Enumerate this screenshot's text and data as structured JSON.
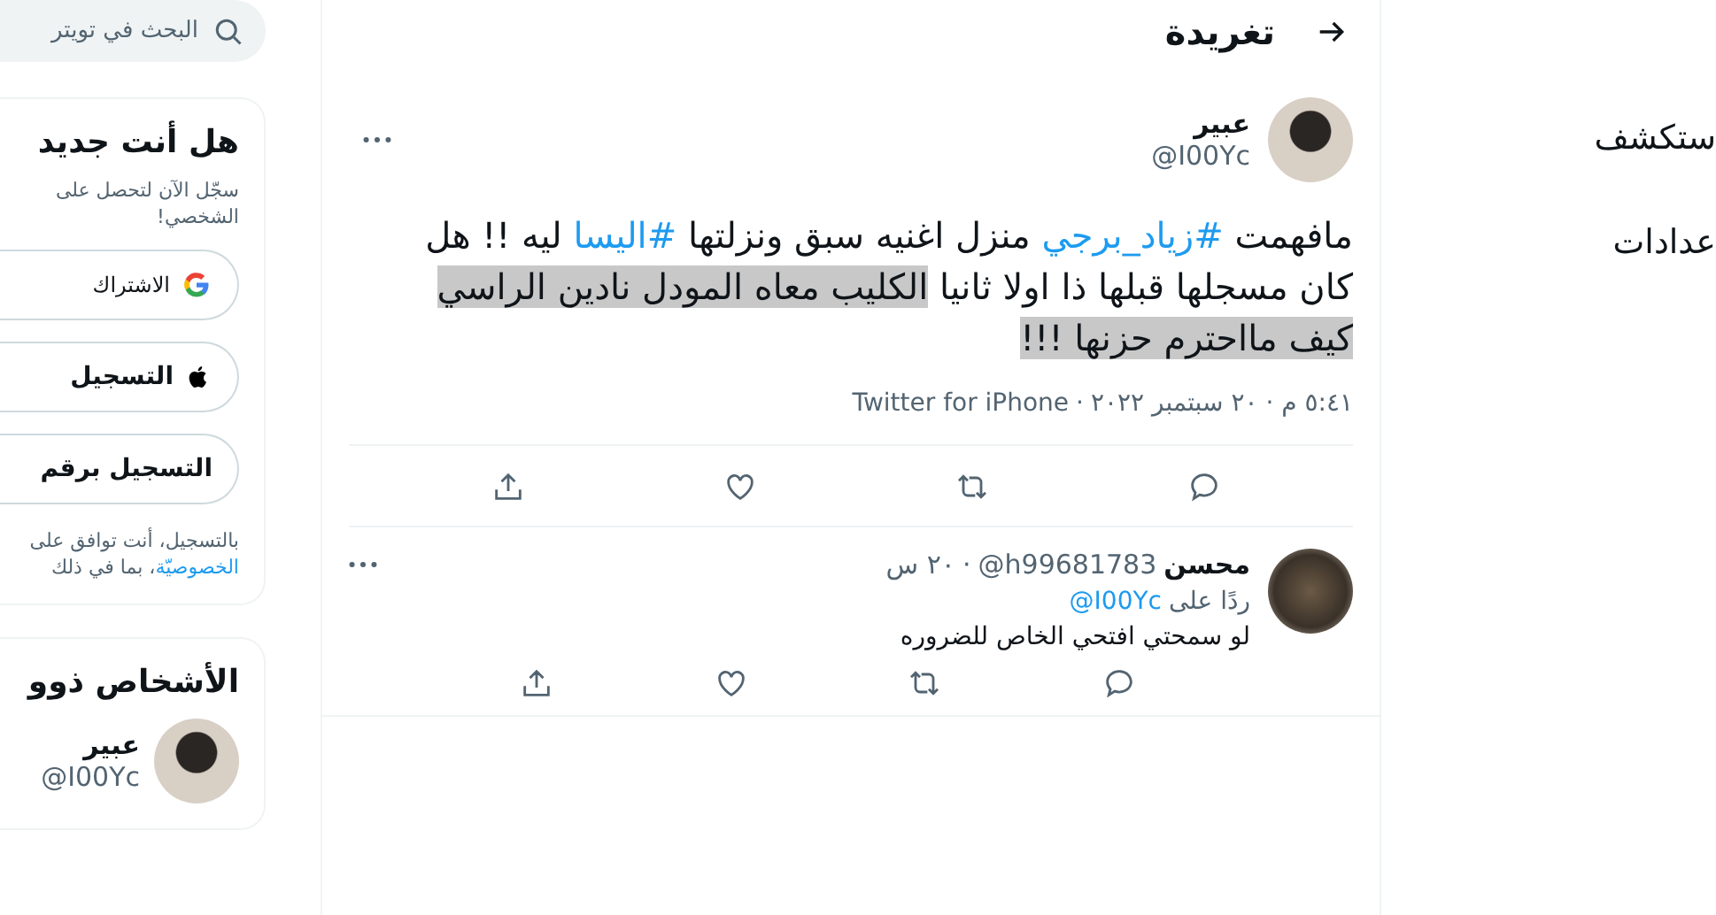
{
  "nav": {
    "items": [
      {
        "label": "ستكشف"
      },
      {
        "label": "عدادات"
      }
    ]
  },
  "header": {
    "title": "تغريدة"
  },
  "main_tweet": {
    "author": {
      "name": "عبير",
      "handle": "@I00Yc"
    },
    "text_segments": [
      {
        "kind": "text",
        "text": "مافهمت "
      },
      {
        "kind": "hashtag",
        "text": "#زياد_برجي"
      },
      {
        "kind": "text",
        "text": " منزل اغنيه سبق ونزلتها "
      },
      {
        "kind": "hashtag",
        "text": "#اليسا"
      },
      {
        "kind": "text",
        "text": " ليه !! هل كان مسجلها قبلها ذا اولا ثانيا "
      },
      {
        "kind": "highlighted",
        "text": "الكليب معاه المودل نادين الراسي كيف مااحترم حزنها !!!"
      }
    ],
    "timestamp": "٥:٤١ م · ٢٠ سبتمبر ٢٠٢٢",
    "separator": "·",
    "source": "Twitter for iPhone"
  },
  "reply": {
    "author": {
      "name": "محسن",
      "handle": "@h99681783"
    },
    "separator": "·",
    "time": "٢٠ س",
    "replying_to": "ردًا على",
    "mention": "@I00Yc",
    "text": "لو سمحتي افتحي الخاص للضروره"
  },
  "sidebar": {
    "search": {
      "placeholder": "البحث في تويتر"
    },
    "signup_card": {
      "title": "هل أنت جديد",
      "description_lines": [
        "سجّل الآن لتحصل على",
        "الشخصي!"
      ],
      "buttons": [
        {
          "kind": "google",
          "label": "الاشتراك"
        },
        {
          "kind": "apple",
          "label": "التسجيل"
        },
        {
          "kind": "phone",
          "label": "التسجيل برقم"
        }
      ],
      "legal_line": "بالتسجيل، أنت توافق على",
      "legal_link": "الخصوصيّة",
      "legal_rest": "، بما في ذلك"
    },
    "people_card": {
      "title": "الأشخاص ذوو",
      "person": {
        "name": "عبير",
        "handle": "@I00Yc"
      }
    }
  }
}
